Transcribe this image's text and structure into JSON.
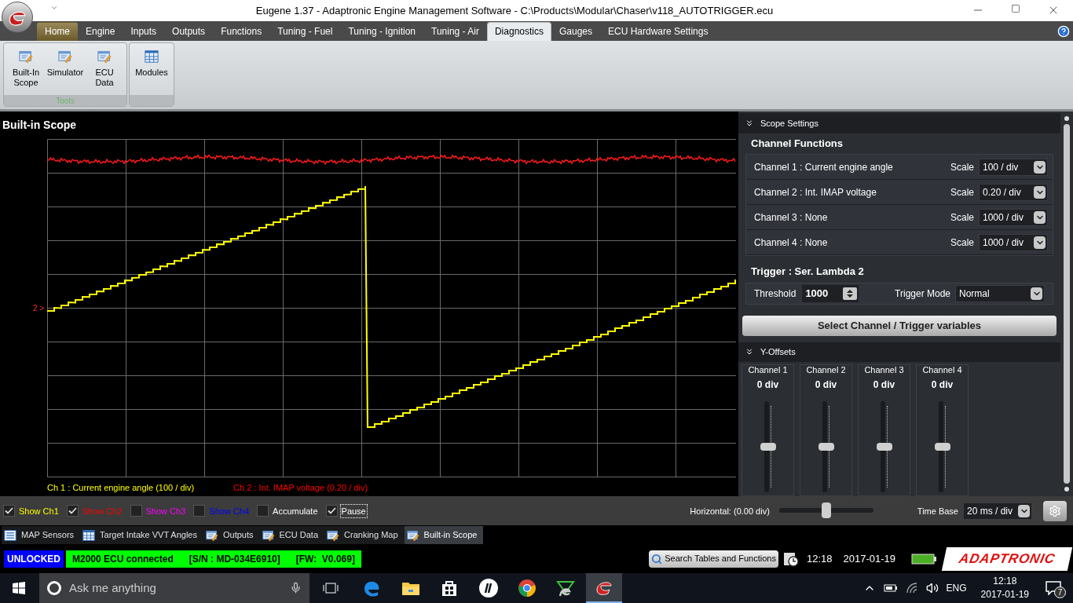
{
  "window": {
    "title": "Eugene 1.37 - Adaptronic Engine Management Software - C:\\Products\\Modular\\Chaser\\v118_AUTOTRIGGER.ecu"
  },
  "ribbon_tabs": [
    {
      "label": "Home",
      "selected": false,
      "highlighted": true
    },
    {
      "label": "Engine",
      "selected": false,
      "highlighted": false
    },
    {
      "label": "Inputs",
      "selected": false,
      "highlighted": false
    },
    {
      "label": "Outputs",
      "selected": false,
      "highlighted": false
    },
    {
      "label": "Functions",
      "selected": false,
      "highlighted": false
    },
    {
      "label": "Tuning - Fuel",
      "selected": false,
      "highlighted": false
    },
    {
      "label": "Tuning - Ignition",
      "selected": false,
      "highlighted": false
    },
    {
      "label": "Tuning - Air",
      "selected": false,
      "highlighted": false
    },
    {
      "label": "Diagnostics",
      "selected": true,
      "highlighted": false
    },
    {
      "label": "Gauges",
      "selected": false,
      "highlighted": false
    },
    {
      "label": "ECU Hardware Settings",
      "selected": false,
      "highlighted": false
    }
  ],
  "ribbon_groups": [
    {
      "label": "Tools",
      "buttons": [
        {
          "label": "Built-In Scope",
          "kind": "edit"
        },
        {
          "label": "Simulator",
          "kind": "edit"
        },
        {
          "label": "ECU Data",
          "kind": "edit"
        }
      ]
    },
    {
      "buttons": [
        {
          "label": "Modules",
          "kind": "grid"
        }
      ]
    }
  ],
  "scope": {
    "title": "Built-in Scope",
    "marker": "2 >",
    "legend": [
      {
        "text": "Ch 1 : Current engine angle (100 / div)",
        "color": "#ffff00"
      },
      {
        "text": "Ch 2 : Int. IMAP voltage (0.20 / div)",
        "color": "#ff0000"
      }
    ]
  },
  "scope_settings": {
    "header": "Scope Settings",
    "title": "Channel Functions",
    "channels": [
      {
        "label": "Channel 1 : Current engine angle",
        "scale_label": "Scale",
        "scale": "100 / div"
      },
      {
        "label": "Channel 2 : Int. IMAP voltage",
        "scale_label": "Scale",
        "scale": "0.20 / div"
      },
      {
        "label": "Channel 3 : None",
        "scale_label": "Scale",
        "scale": "1000 / div"
      },
      {
        "label": "Channel 4 : None",
        "scale_label": "Scale",
        "scale": "1000 / div"
      }
    ],
    "trigger": {
      "title": "Trigger : Ser. Lambda 2",
      "threshold_label": "Threshold",
      "threshold": "1000",
      "mode_label": "Trigger Mode",
      "mode": "Normal"
    },
    "select_button": "Select Channel / Trigger variables"
  },
  "y_offsets": {
    "header": "Y-Offsets",
    "channels": [
      {
        "label": "Channel 1",
        "value": "0 div",
        "level": 0.5
      },
      {
        "label": "Channel 2",
        "value": "0 div",
        "level": 0.5
      },
      {
        "label": "Channel 3",
        "value": "0 div",
        "level": 0.5
      },
      {
        "label": "Channel 4",
        "value": "0 div",
        "level": 0.5
      }
    ]
  },
  "bottom_bar": {
    "checkboxes": [
      {
        "label": "Show Ch1",
        "checked": true,
        "color": "#ffff00",
        "focused": false
      },
      {
        "label": "Show Ch2",
        "checked": true,
        "color": "#ff0000",
        "focused": false
      },
      {
        "label": "Show Ch3",
        "checked": false,
        "color": "#ff00ff",
        "focused": false
      },
      {
        "label": "Show Ch4",
        "checked": false,
        "color": "#0000ff",
        "focused": false
      },
      {
        "label": "Accumulate",
        "checked": false,
        "color": "#ffffff",
        "focused": false
      },
      {
        "label": "Pause",
        "checked": true,
        "color": "#ffffff",
        "focused": true
      }
    ],
    "horizontal": {
      "label": "Horizontal: (0.00 div)",
      "level": 0.5
    },
    "time_base": {
      "label": "Time Base",
      "value": "20 ms / div"
    }
  },
  "document_tabs": [
    {
      "label": "MAP Sensors",
      "kind": "list",
      "selected": false
    },
    {
      "label": "Target Intake VVT Angles",
      "kind": "grid",
      "selected": false
    },
    {
      "label": "Outputs",
      "kind": "edit",
      "selected": false
    },
    {
      "label": "ECU Data",
      "kind": "edit",
      "selected": false
    },
    {
      "label": "Cranking Map",
      "kind": "edit",
      "selected": false
    },
    {
      "label": "Built-in Scope",
      "kind": "edit",
      "selected": true
    }
  ],
  "status_bar": {
    "lock": "UNLOCKED",
    "connection": "M2000 ECU connected",
    "serial": "[S/N : MD-034E6910]",
    "firmware": "[FW:  V0.069]",
    "search_button": "Search Tables and Functions",
    "time": "12:18",
    "date": "2017-01-19",
    "brand": "ADAPTRONIC"
  },
  "taskbar": {
    "search_placeholder": "Ask me anything",
    "language": "ENG",
    "time": "12:18",
    "date": "2017-01-19",
    "notification_count": "7"
  }
}
